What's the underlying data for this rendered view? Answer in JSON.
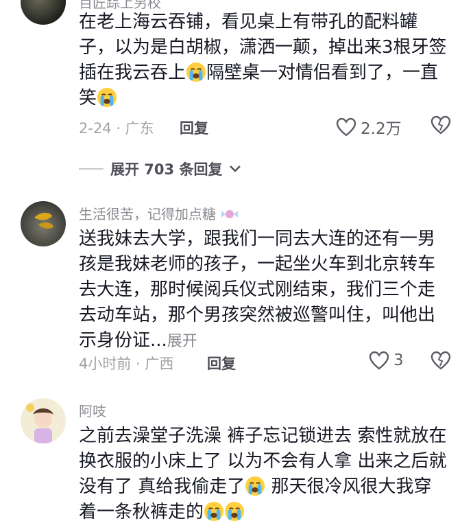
{
  "comments": [
    {
      "username": "百匠踪上另校",
      "text": "在老上海云吞铺，看见桌上有带孔的配料罐子，以为是白胡椒，潇洒一颠，掉出来3根牙签插在我云吞上",
      "text_after_emoji": "隔壁桌一对情侣看到了，一直笑",
      "emoji": "crying-face",
      "meta": "2-24 · 广东",
      "reply_label": "回复",
      "likes": "2.2万"
    },
    {
      "username": "生活很苦，记得加点糖",
      "text": "送我妹去大学，跟我们一同去大连的还有一男孩是我妹老师的孩子，一起坐火车到北京转车去大连，那时候阅兵仪式刚结束，我们三个走去动车站，那个男孩突然被巡警叫住，叫他出示身份证...",
      "more_label": "展开",
      "meta": "4小时前 · 广西",
      "reply_label": "回复",
      "likes": "3"
    },
    {
      "username": "阿吱",
      "text": "之前去澡堂子洗澡 裤子忘记锁进去 索性就放在换衣服的小床上了 以为不会有人拿 出来之后就没有了 真给我偷走了",
      "text_after_emoji": "那天很冷风很大我穿着一条秋裤走的",
      "emoji": "crying-face"
    }
  ],
  "expand_replies": {
    "label": "展开 703 条回复"
  },
  "colors": {
    "text": "#161823",
    "muted": "#a1a2a7",
    "username": "#8a8b91"
  }
}
